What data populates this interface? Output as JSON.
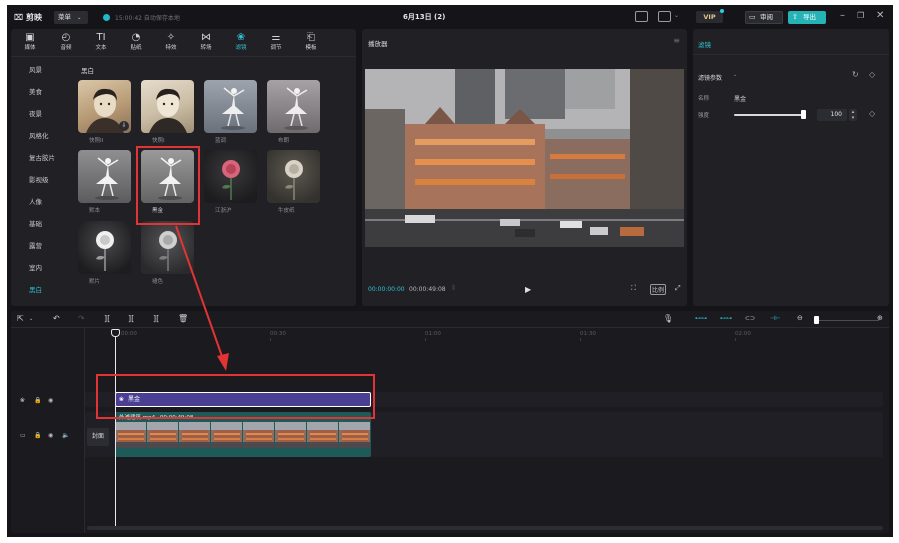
{
  "titlebar": {
    "logo": "剪映",
    "menu_label": "菜单",
    "save_status": "15:00:42 自动保存本地",
    "project_title": "6月13日 (2)",
    "vip_label": "VIP",
    "review_label": "审阅",
    "export_label": "导出",
    "accent_color": "#26b3b6"
  },
  "tabs": [
    {
      "label": "媒体",
      "icon": "media-icon"
    },
    {
      "label": "音频",
      "icon": "audio-icon"
    },
    {
      "label": "文本",
      "icon": "text-icon"
    },
    {
      "label": "贴纸",
      "icon": "sticker-icon"
    },
    {
      "label": "特效",
      "icon": "effects-icon"
    },
    {
      "label": "转场",
      "icon": "transition-icon"
    },
    {
      "label": "滤镜",
      "icon": "filter-icon"
    },
    {
      "label": "调节",
      "icon": "adjust-icon"
    },
    {
      "label": "模板",
      "icon": "template-icon"
    }
  ],
  "active_tab": "滤镜",
  "sidebar": {
    "items": [
      "风景",
      "美食",
      "夜景",
      "风格化",
      "复古胶片",
      "影视级",
      "人像",
      "基础",
      "露营",
      "室内",
      "黑白"
    ],
    "active": "黑白"
  },
  "filter_grid": {
    "section_title": "黑白",
    "items": [
      {
        "label": "快照II"
      },
      {
        "label": "快照I"
      },
      {
        "label": "蓝调"
      },
      {
        "label": "布朗"
      },
      {
        "label": "默本"
      },
      {
        "label": "黑金"
      },
      {
        "label": "江浙沪"
      },
      {
        "label": "牛皮纸"
      },
      {
        "label": "默片"
      },
      {
        "label": "褪色"
      }
    ],
    "selected": "黑金"
  },
  "player": {
    "title": "播放器",
    "current_time": "00:00:00:00",
    "total_time": "00:00:49:08",
    "ratio_label": "比例"
  },
  "right_panel": {
    "tab_label": "滤镜",
    "section_label": "滤镜参数",
    "name_label": "名称",
    "name_value": "黑金",
    "intensity_label": "强度",
    "intensity_value": "100",
    "intensity_level": 1.0
  },
  "timeline": {
    "ruler": [
      "00:00",
      "00:30",
      "01:00",
      "01:30",
      "02:00"
    ],
    "filter_clip_label": "黑金",
    "video_clip_name": "外滩建筑.mp4",
    "video_clip_duration": "00:00:49:08",
    "cover_label": "封面"
  }
}
